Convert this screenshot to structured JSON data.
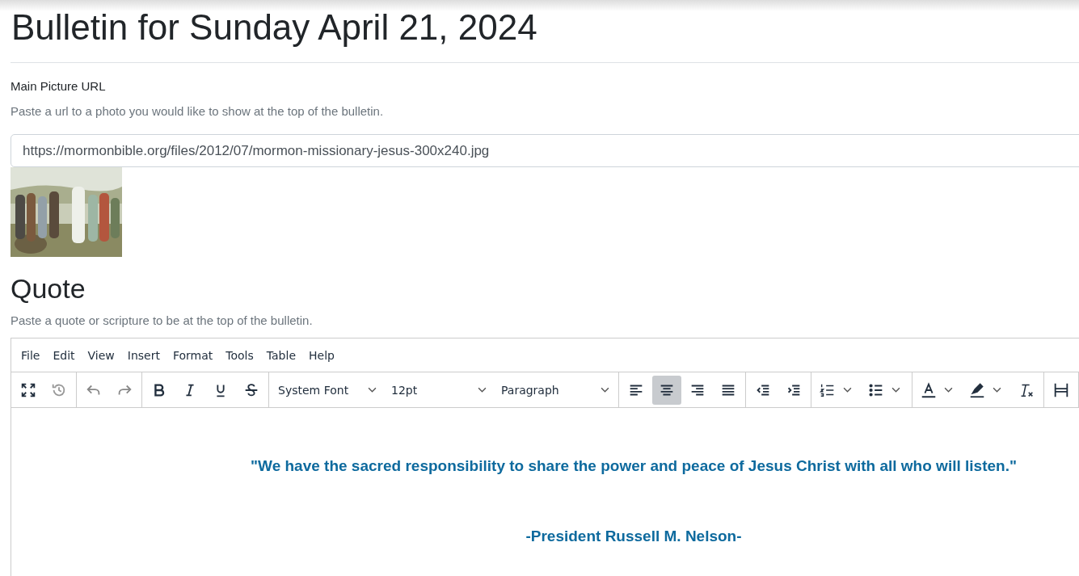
{
  "page_title": "Bulletin for Sunday April 21, 2024",
  "picture_field": {
    "label": "Main Picture URL",
    "help": "Paste a url to a photo you would like to show at the top of the bulletin.",
    "value": "https://mormonbible.org/files/2012/07/mormon-missionary-jesus-300x240.jpg"
  },
  "quote_section": {
    "heading": "Quote",
    "help": "Paste a quote or scripture to be at the top of the bulletin.",
    "editor": {
      "menubar": [
        "File",
        "Edit",
        "View",
        "Insert",
        "Format",
        "Tools",
        "Table",
        "Help"
      ],
      "toolbar": [
        [
          {
            "kind": "fullscreen"
          },
          {
            "kind": "history"
          }
        ],
        [
          {
            "kind": "undo"
          },
          {
            "kind": "redo"
          }
        ],
        [
          {
            "kind": "bold"
          },
          {
            "kind": "italic"
          },
          {
            "kind": "underline"
          },
          {
            "kind": "strike"
          }
        ],
        [
          {
            "kind": "select",
            "value": "System Font"
          },
          {
            "kind": "select",
            "value": "12pt"
          },
          {
            "kind": "select",
            "value": "Paragraph"
          }
        ],
        [
          {
            "kind": "alignleft",
            "selected": false
          },
          {
            "kind": "aligncenter",
            "selected": true
          },
          {
            "kind": "alignright",
            "selected": false
          },
          {
            "kind": "justify",
            "selected": false
          }
        ],
        [
          {
            "kind": "outdent"
          },
          {
            "kind": "indent"
          }
        ],
        [
          {
            "kind": "numlist"
          },
          {
            "kind": "bullist"
          }
        ],
        [
          {
            "kind": "forecolor"
          },
          {
            "kind": "highlight"
          },
          {
            "kind": "clearformat"
          }
        ],
        [
          {
            "kind": "table"
          }
        ]
      ],
      "content": [
        "\"We have the sacred responsibility to share the power and peace of Jesus Christ with all who will listen.\"",
        "-President Russell M. Nelson-"
      ]
    }
  }
}
